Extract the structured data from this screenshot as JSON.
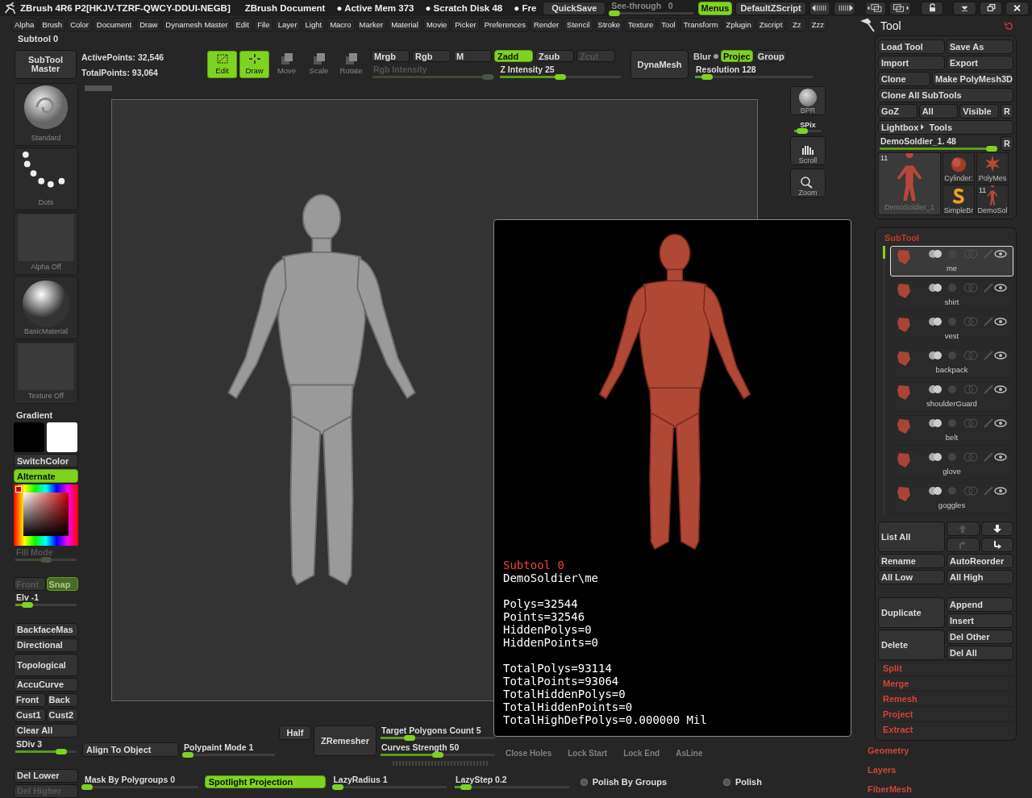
{
  "title_bar": {
    "app_title": "ZBrush 4R6 P2[HKJV-TZRF-QWCY-DDUI-NEGB]",
    "document_title": "ZBrush Document",
    "stats": [
      "● Active Mem 373",
      "● Scratch Disk 48",
      "● Fre"
    ],
    "quicksave": "QuickSave",
    "see_through": {
      "label": "See-through",
      "value": "0",
      "level": 0.05
    },
    "menus_toggle": {
      "label": "Menus",
      "on": true
    },
    "script_name": "DefaultZScript"
  },
  "menu_bar": [
    "Alpha",
    "Brush",
    "Color",
    "Document",
    "Draw",
    "Dynamesh Master",
    "Edit",
    "File",
    "Layer",
    "Light",
    "Macro",
    "Marker",
    "Material",
    "Movie",
    "Picker",
    "Preferences",
    "Render",
    "Stencil",
    "Stroke",
    "Texture",
    "Tool",
    "Transform",
    "Zplugin",
    "Zscript",
    "Zz",
    "Zzz"
  ],
  "subtool_indicator": "Subtool 0",
  "top_shelf": {
    "subtool_master": "SubTool Master",
    "active_points": "ActivePoints: 32,546",
    "total_points": "TotalPoints: 93,064",
    "tools": [
      {
        "label": "Edit",
        "kind": "edit",
        "on": true
      },
      {
        "label": "Draw",
        "kind": "draw",
        "on": true
      },
      {
        "label": "Move",
        "kind": "move",
        "on": false
      },
      {
        "label": "Scale",
        "kind": "scale",
        "on": false
      },
      {
        "label": "Rotate",
        "kind": "rotate",
        "on": false
      }
    ],
    "color_modes": [
      {
        "label": "Mrgb",
        "on": false,
        "disabled": false
      },
      {
        "label": "Rgb",
        "on": false,
        "disabled": false
      },
      {
        "label": "M",
        "on": false,
        "disabled": false
      }
    ],
    "z_modes": [
      {
        "label": "Zadd",
        "on": true,
        "disabled": false
      },
      {
        "label": "Zsub",
        "on": false,
        "disabled": false
      },
      {
        "label": "Zcut",
        "on": false,
        "disabled": true
      }
    ],
    "rgb_intensity": {
      "label": "Rgb Intensity",
      "level": 0.95,
      "disabled": true
    },
    "z_intensity": {
      "label": "Z Intensity",
      "value": "25",
      "level": 0.5,
      "disabled": false
    },
    "dynamesh": "DynaMesh",
    "blur": "Blur",
    "project": {
      "label": "Projec",
      "on": true
    },
    "group": "Group",
    "resolution": {
      "label": "Resolution",
      "value": "128",
      "level": 0.1,
      "disabled": false
    }
  },
  "brush_palette": [
    {
      "label": "Standard",
      "kind": "standard"
    },
    {
      "label": "Dots",
      "kind": "dots"
    },
    {
      "label": "Alpha Off",
      "kind": "alpha"
    },
    {
      "label": "BasicMaterial",
      "kind": "material"
    },
    {
      "label": "Texture Off",
      "kind": "texture"
    }
  ],
  "left_controls": [
    {
      "kind": "heading",
      "label": "Gradient"
    },
    {
      "kind": "swatches",
      "items": [
        {
          "color": "#000000"
        },
        {
          "color": "#ffffff"
        }
      ]
    },
    {
      "kind": "button",
      "label": "SwitchColor",
      "on": false,
      "disabled": false
    },
    {
      "kind": "button",
      "label": "Alternate",
      "on": true,
      "disabled": false
    },
    {
      "kind": "picker"
    },
    {
      "kind": "slider",
      "label": "Fill Mode",
      "level": 0.5,
      "disabled": true
    },
    {
      "kind": "pair",
      "items": [
        {
          "label": "Front",
          "on": false,
          "disabled": true
        },
        {
          "label": "Snap",
          "on": true,
          "disabled": true
        }
      ]
    },
    {
      "kind": "slider",
      "label": "Elv",
      "value": "-1",
      "level": 0.2,
      "disabled": false
    },
    {
      "kind": "button",
      "label": "BackfaceMas",
      "on": false,
      "disabled": false
    },
    {
      "kind": "button",
      "label": "Directional",
      "on": false,
      "disabled": false
    },
    {
      "kind": "tall",
      "label": "Topological",
      "on": false,
      "disabled": false
    },
    {
      "kind": "button",
      "label": "AccuCurve",
      "on": false,
      "disabled": false
    },
    {
      "kind": "pair",
      "items": [
        {
          "label": "Front",
          "on": false,
          "disabled": false
        },
        {
          "label": "Back",
          "on": false,
          "disabled": false
        }
      ]
    },
    {
      "kind": "pair",
      "items": [
        {
          "label": "Cust1",
          "on": false,
          "disabled": false
        },
        {
          "label": "Cust2",
          "on": false,
          "disabled": false
        }
      ]
    },
    {
      "kind": "button",
      "label": "Clear All",
      "on": false,
      "disabled": false
    },
    {
      "kind": "slider",
      "label": "SDiv",
      "value": "3",
      "level": 0.75,
      "disabled": false
    },
    {
      "kind": "button",
      "label": "Del Lower",
      "on": false,
      "disabled": false
    },
    {
      "kind": "button",
      "label": "Del Higher",
      "on": false,
      "disabled": true
    }
  ],
  "right_shelf": [
    {
      "label": "BPR",
      "kind": "bpr"
    },
    {
      "label": "SPix",
      "kind": "spix",
      "level": 0.3
    },
    {
      "label": "Scroll",
      "kind": "scroll"
    },
    {
      "label": "Zoom",
      "kind": "zoom"
    }
  ],
  "bottom_shelf": {
    "row_1": [
      {
        "kind": "button",
        "label": "Half",
        "on": false,
        "disabled": false
      },
      {
        "kind": "button",
        "label": "Align To Object",
        "on": false,
        "disabled": false
      },
      {
        "kind": "slider",
        "label": "Polypaint Mode 1",
        "level": 0.05,
        "disabled": false
      },
      {
        "kind": "button",
        "label": "ZRemesher",
        "on": false,
        "disabled": false
      },
      {
        "kind": "slider",
        "label": "Target Polygons Count 5",
        "level": 0.25,
        "disabled": false
      },
      {
        "kind": "slider",
        "label": "Curves Strength 50",
        "level": 0.5,
        "disabled": false
      }
    ],
    "row_1_hidden": [
      "Close Holes",
      "Lock Start",
      "Lock End",
      "AsLine"
    ],
    "row_2": [
      {
        "kind": "slider",
        "label": "Mask By Polygroups 0",
        "level": 0.03,
        "disabled": false
      },
      {
        "kind": "button",
        "label": "Spotlight Projection",
        "on": true,
        "disabled": false
      },
      {
        "kind": "slider",
        "label": "LazyRadius 1",
        "level": 0.05,
        "disabled": false
      },
      {
        "kind": "slider",
        "label": "LazyStep 0.2",
        "level": 0.1,
        "disabled": false
      },
      {
        "kind": "radio",
        "label": "Polish By Groups",
        "on": false
      },
      {
        "kind": "radio",
        "label": "Polish",
        "on": false
      }
    ]
  },
  "subtool_popup": {
    "title": "Subtool 0",
    "path": "DemoSoldier\\me",
    "stats": [
      "Polys=32544",
      "Points=32546",
      "HiddenPolys=0",
      "HiddenPoints=0"
    ],
    "totals": [
      "TotalPolys=93114",
      "TotalPoints=93064",
      "TotalHiddenPolys=0",
      "TotalHiddenPoints=0",
      "TotalHighDefPolys=0.000000 Mil"
    ]
  },
  "tool_panel": {
    "title": "Tool",
    "button_rows": [
      [
        {
          "label": "Load Tool"
        },
        {
          "label": "Save As"
        }
      ],
      [
        {
          "label": "Import"
        },
        {
          "label": "Export"
        }
      ],
      [
        {
          "label": "Clone"
        },
        {
          "label": "Make PolyMesh3D"
        }
      ],
      [
        {
          "label": "Clone All SubTools"
        }
      ],
      [
        {
          "label": "GoZ"
        },
        {
          "label": "All"
        },
        {
          "label": "Visible"
        },
        {
          "label": "R"
        }
      ]
    ],
    "lightbox": {
      "label": "Lightbox",
      "target": "Tools"
    },
    "current_tool": {
      "label": "DemoSoldier_1. 48",
      "level": 0.95
    },
    "current_tool_reset": "R",
    "thumbnails": [
      {
        "label": "DemoSoldier_1",
        "kind": "figure",
        "count": "11"
      },
      {
        "label": "Cylinder:",
        "kind": "cylinder"
      },
      {
        "label": "PolyMes",
        "kind": "star"
      },
      {
        "label": "SimpleBr",
        "kind": "s"
      },
      {
        "label": "DemoSol",
        "kind": "figure",
        "count": "11"
      }
    ],
    "subtool": {
      "title": "SubTool",
      "items": [
        {
          "name": "me",
          "selected": true
        },
        {
          "name": "shirt",
          "selected": false
        },
        {
          "name": "vest",
          "selected": false
        },
        {
          "name": "backpack",
          "selected": false
        },
        {
          "name": "shoulderGuard",
          "selected": false
        },
        {
          "name": "belt",
          "selected": false
        },
        {
          "name": "glove",
          "selected": false
        },
        {
          "name": "goggles",
          "selected": false
        }
      ],
      "list_all": "List All",
      "rename": "Rename",
      "auto_reorder": "AutoReorder",
      "all_low": "All Low",
      "all_high": "All High",
      "duplicate": "Duplicate",
      "append": "Append",
      "insert": "Insert",
      "delete": "Delete",
      "del_other": "Del Other",
      "del_all": "Del All",
      "sections": [
        "Split",
        "Merge",
        "Remesh",
        "Project",
        "Extract"
      ]
    },
    "more_sections": [
      "Geometry",
      "Layers",
      "FiberMesh"
    ]
  }
}
